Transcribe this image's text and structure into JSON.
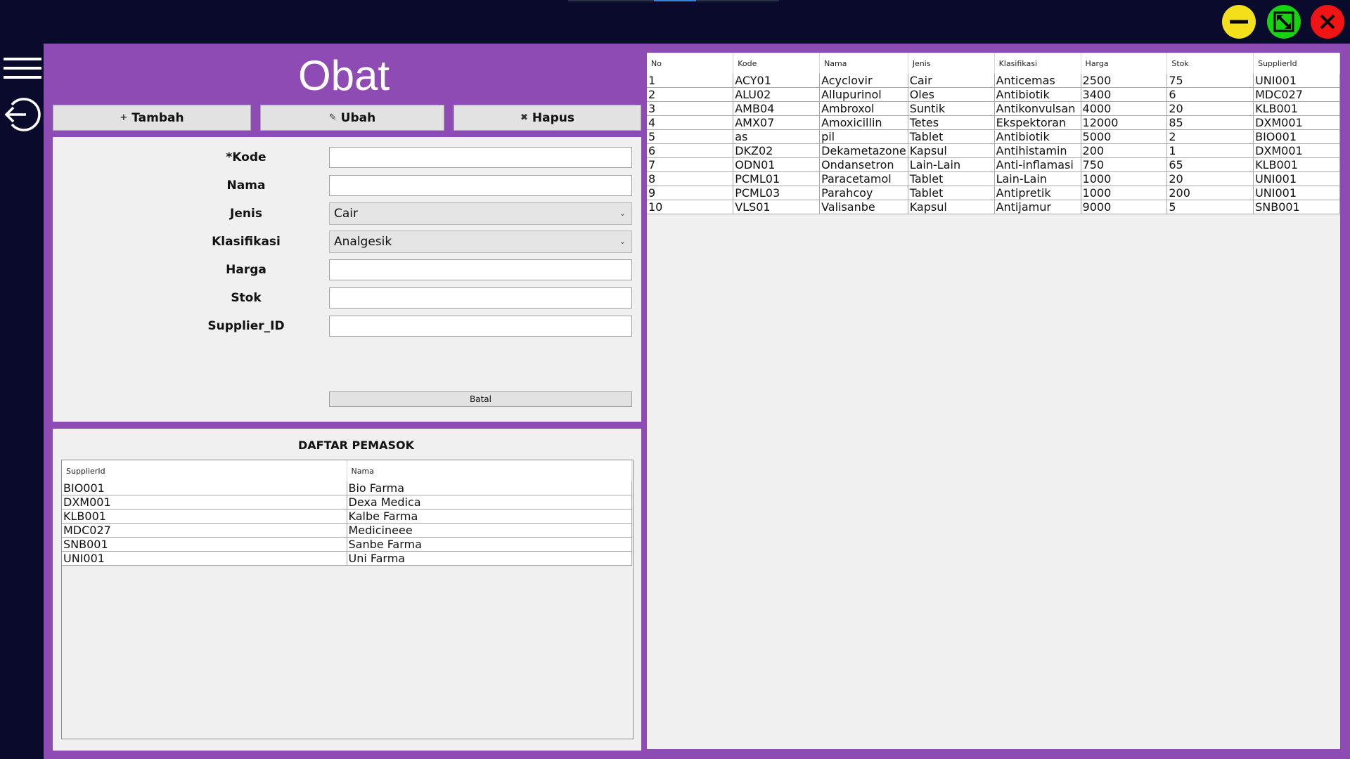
{
  "window": {
    "title": "Obat",
    "controls": {
      "minimize": "minimize",
      "maximize": "maximize",
      "close": "close"
    },
    "colors": {
      "background": "#0a0b2c",
      "frame": "#8e4bb4",
      "minimize": "#f3e01b",
      "maximize": "#16d410",
      "close": "#f01414"
    }
  },
  "sidebar": {
    "menu_icon": "hamburger-menu-icon",
    "logout_icon": "logout-icon"
  },
  "toolbar": {
    "tambah_label": "Tambah",
    "tambah_glyph": "+",
    "ubah_label": "Ubah",
    "ubah_glyph": "✎",
    "hapus_label": "Hapus",
    "hapus_glyph": "✖"
  },
  "form": {
    "kode_label": "*Kode",
    "kode_value": "",
    "nama_label": "Nama",
    "nama_value": "",
    "jenis_label": "Jenis",
    "jenis_value": "Cair",
    "klasifikasi_label": "Klasifikasi",
    "klasifikasi_value": "Analgesik",
    "harga_label": "Harga",
    "harga_value": "",
    "stok_label": "Stok",
    "stok_value": "",
    "supplier_label": "Supplier_ID",
    "supplier_value": "",
    "batal_label": "Batal"
  },
  "suppliers": {
    "title": "DAFTAR PEMASOK",
    "headers": [
      "SupplierId",
      "Nama"
    ],
    "rows": [
      [
        "BIO001",
        "Bio Farma"
      ],
      [
        "DXM001",
        "Dexa Medica"
      ],
      [
        "KLB001",
        "Kalbe Farma"
      ],
      [
        "MDC027",
        "Medicineee"
      ],
      [
        "SNB001",
        "Sanbe Farma"
      ],
      [
        "UNI001",
        "Uni Farma"
      ]
    ]
  },
  "obat_table": {
    "headers": [
      "No",
      "Kode",
      "Nama",
      "Jenis",
      "Klasifikasi",
      "Harga",
      "Stok",
      "SupplierId"
    ],
    "rows": [
      [
        "1",
        "ACY01",
        "Acyclovir",
        "Cair",
        "Anticemas",
        "2500",
        "75",
        "UNI001"
      ],
      [
        "2",
        "ALU02",
        "Allupurinol",
        "Oles",
        "Antibiotik",
        "3400",
        "6",
        "MDC027"
      ],
      [
        "3",
        "AMB04",
        "Ambroxol",
        "Suntik",
        "Antikonvulsan",
        "4000",
        "20",
        "KLB001"
      ],
      [
        "4",
        "AMX07",
        "Amoxicillin",
        "Tetes",
        "Ekspektoran",
        "12000",
        "85",
        "DXM001"
      ],
      [
        "5",
        "as",
        "pil",
        "Tablet",
        "Antibiotik",
        "5000",
        "2",
        "BIO001"
      ],
      [
        "6",
        "DKZ02",
        "Dekametazone",
        "Kapsul",
        "Antihistamin",
        "200",
        "1",
        "DXM001"
      ],
      [
        "7",
        "ODN01",
        "Ondansetron",
        "Lain-Lain",
        "Anti-inflamasi",
        "750",
        "65",
        "KLB001"
      ],
      [
        "8",
        "PCML01",
        "Paracetamol",
        "Tablet",
        "Lain-Lain",
        "1000",
        "20",
        "UNI001"
      ],
      [
        "9",
        "PCML03",
        "Parahcoy",
        "Tablet",
        "Antipretik",
        "1000",
        "200",
        "UNI001"
      ],
      [
        "10",
        "VLS01",
        "Valisanbe",
        "Kapsul",
        "Antijamur",
        "9000",
        "5",
        "SNB001"
      ]
    ]
  }
}
